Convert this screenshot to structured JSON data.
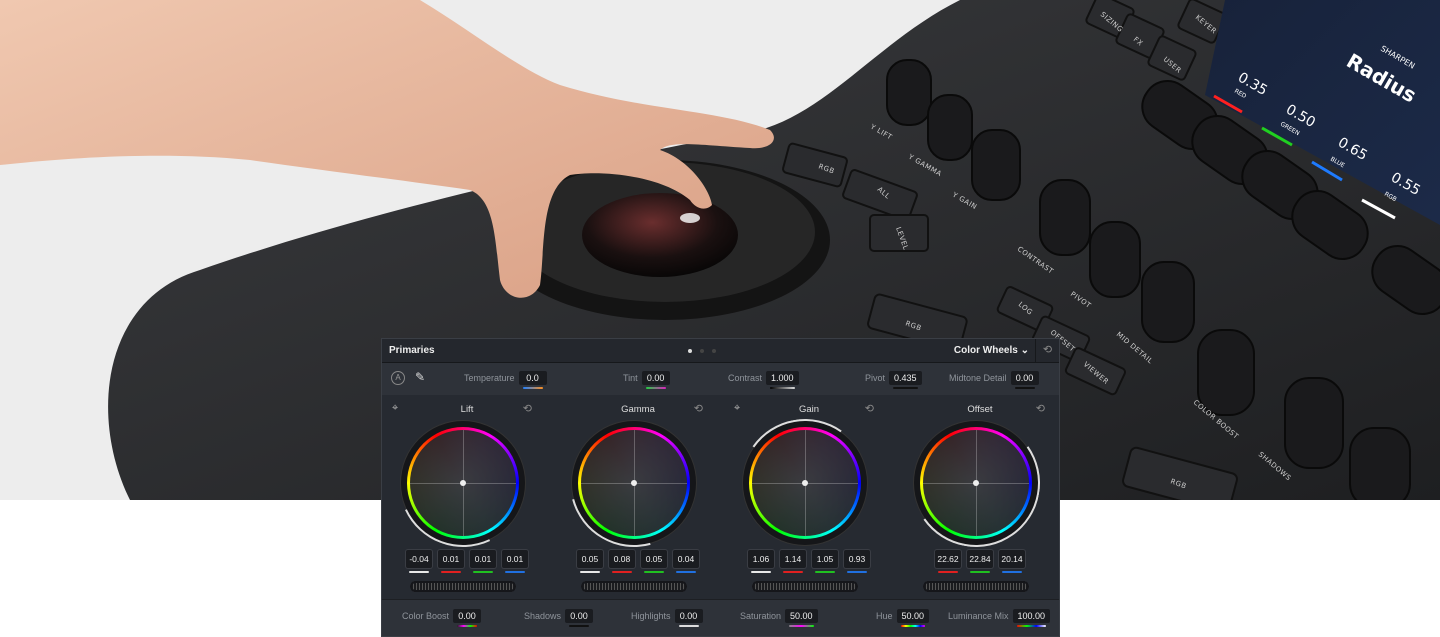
{
  "hardware": {
    "keys": [
      "SIZING",
      "FX",
      "USER",
      "KEYER",
      "RGB",
      "ALL",
      "LEVEL",
      "LOG",
      "OFFSET",
      "VIEWER",
      "RGB",
      "RGB"
    ],
    "knob_labels": [
      "Y LIFT",
      "Y GAMMA",
      "Y GAIN",
      "CONTRAST",
      "PIVOT",
      "MID DETAIL",
      "COLOR BOOST",
      "SHADOWS"
    ],
    "display": {
      "section": "SHARPEN",
      "title": "Radius",
      "channels": [
        {
          "label": "RED",
          "value": "0.35",
          "color": "#ff2020"
        },
        {
          "label": "GREEN",
          "value": "0.50",
          "color": "#20d020"
        },
        {
          "label": "BLUE",
          "value": "0.65",
          "color": "#1e7bff"
        },
        {
          "label": "RGB",
          "value": "0.55",
          "color": "#ff2020"
        }
      ]
    }
  },
  "panel": {
    "title": "Primaries",
    "page_dots": 3,
    "active_page": 1,
    "mode": "Color Wheels",
    "mode_icon": "chevron-down-icon",
    "reset_icon": "reset-icon",
    "top_controls": {
      "auto_icon": "A",
      "picker_icon": "eyedropper-icon",
      "temperature": {
        "label": "Temperature",
        "value": "0.0"
      },
      "tint": {
        "label": "Tint",
        "value": "0.00"
      },
      "contrast": {
        "label": "Contrast",
        "value": "1.000"
      },
      "pivot": {
        "label": "Pivot",
        "value": "0.435"
      },
      "midtone_detail": {
        "label": "Midtone Detail",
        "value": "0.00"
      }
    },
    "wheels": [
      {
        "name": "Lift",
        "values": [
          "-0.04",
          "0.01",
          "0.01",
          "0.01"
        ]
      },
      {
        "name": "Gamma",
        "values": [
          "0.05",
          "0.08",
          "0.05",
          "0.04"
        ]
      },
      {
        "name": "Gain",
        "values": [
          "1.06",
          "1.14",
          "1.05",
          "0.93"
        ]
      },
      {
        "name": "Offset",
        "values": [
          "22.62",
          "22.84",
          "20.14"
        ]
      }
    ],
    "bottom_controls": {
      "color_boost": {
        "label": "Color Boost",
        "value": "0.00"
      },
      "shadows": {
        "label": "Shadows",
        "value": "0.00"
      },
      "highlights": {
        "label": "Highlights",
        "value": "0.00"
      },
      "saturation": {
        "label": "Saturation",
        "value": "50.00"
      },
      "hue": {
        "label": "Hue",
        "value": "50.00"
      },
      "luminance_mix": {
        "label": "Luminance Mix",
        "value": "100.00"
      }
    },
    "colors": {
      "white": "#e8e8e8",
      "red": "#e02020",
      "green": "#20c020",
      "blue": "#2070e0"
    }
  }
}
